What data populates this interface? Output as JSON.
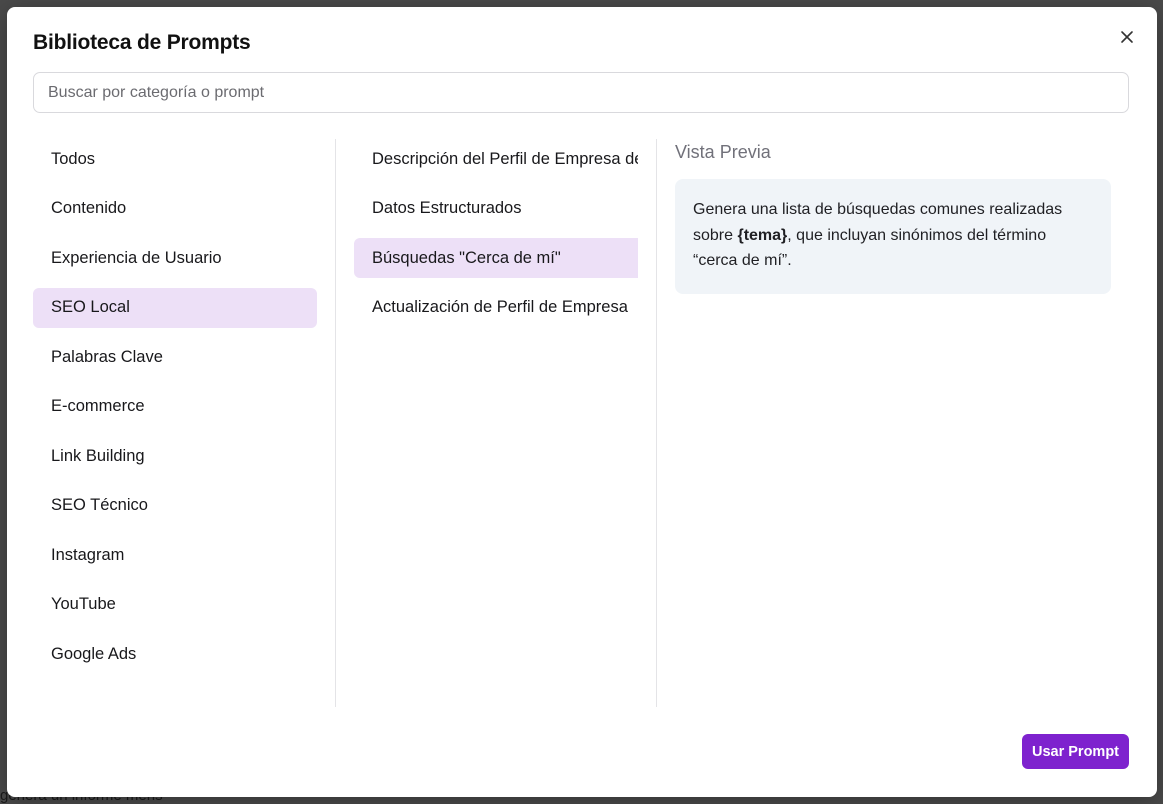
{
  "background": {
    "peek_text": "genera un informe mens"
  },
  "modal": {
    "title": "Biblioteca de Prompts",
    "search_placeholder": "Buscar por categoría o prompt",
    "search_value": ""
  },
  "categories": [
    {
      "label": "Todos",
      "active": false
    },
    {
      "label": "Contenido",
      "active": false
    },
    {
      "label": "Experiencia de Usuario",
      "active": false
    },
    {
      "label": "SEO Local",
      "active": true
    },
    {
      "label": "Palabras Clave",
      "active": false
    },
    {
      "label": "E-commerce",
      "active": false
    },
    {
      "label": "Link Building",
      "active": false
    },
    {
      "label": "SEO Técnico",
      "active": false
    },
    {
      "label": "Instagram",
      "active": false
    },
    {
      "label": "YouTube",
      "active": false
    },
    {
      "label": "Google Ads",
      "active": false
    }
  ],
  "prompts": [
    {
      "label": "Descripción del Perfil de Empresa de Google",
      "active": false
    },
    {
      "label": "Datos Estructurados",
      "active": false
    },
    {
      "label": "Búsquedas \"Cerca de mí\"",
      "active": true
    },
    {
      "label": "Actualización de Perfil de Empresa",
      "active": false
    }
  ],
  "preview": {
    "heading": "Vista Previa",
    "text_before": "Genera una lista de búsquedas comunes realizadas sobre ",
    "highlight": "{tema}",
    "text_after": ", que incluyan sinónimos del término “cerca de mí”."
  },
  "actions": {
    "use_prompt_label": "Usar Prompt"
  },
  "colors": {
    "accent": "#7e22ce",
    "active_item_bg": "#ede0f7",
    "preview_bg": "#f0f4f8"
  }
}
